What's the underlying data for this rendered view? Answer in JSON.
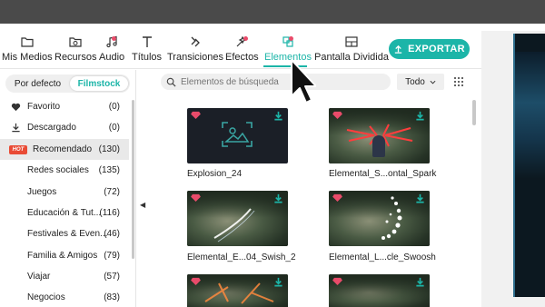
{
  "toolbar": {
    "items": [
      {
        "label": "Mis Medios",
        "icon": "folder-icon"
      },
      {
        "label": "Recursos",
        "icon": "cloud-folder-icon"
      },
      {
        "label": "Audio",
        "icon": "music-note-icon"
      },
      {
        "label": "Títulos",
        "icon": "text-icon"
      },
      {
        "label": "Transiciones",
        "icon": "transition-icon"
      },
      {
        "label": "Efectos",
        "icon": "sparkle-icon"
      },
      {
        "label": "Elementos",
        "icon": "elements-icon"
      },
      {
        "label": "Pantalla Dividida",
        "icon": "split-screen-icon"
      }
    ],
    "active": "Elementos",
    "export_label": "EXPORTAR"
  },
  "sidebar": {
    "segments": [
      "Por defecto",
      "Filmstock"
    ],
    "selected_segment": "Filmstock",
    "categories": [
      {
        "label": "Favorito",
        "count": "(0)",
        "icon": "heart-icon"
      },
      {
        "label": "Descargado",
        "count": "(0)",
        "icon": "download-icon"
      },
      {
        "label": "Recomendado",
        "count": "(130)",
        "icon": "hot-badge-icon",
        "badge": "HOT"
      },
      {
        "label": "Redes sociales",
        "count": "(135)"
      },
      {
        "label": "Juegos",
        "count": "(72)"
      },
      {
        "label": "Educación & Tut...",
        "count": "(116)"
      },
      {
        "label": "Festivales & Even...",
        "count": "(46)"
      },
      {
        "label": "Familia & Amigos",
        "count": "(79)"
      },
      {
        "label": "Viajar",
        "count": "(57)"
      },
      {
        "label": "Negocios",
        "count": "(83)"
      }
    ],
    "selected_category": "Recomendado"
  },
  "search": {
    "placeholder": "Elementos de búsqueda"
  },
  "filter": {
    "label": "Todo"
  },
  "grid": {
    "items": [
      {
        "label": "Explosion_24"
      },
      {
        "label": "Elemental_S...ontal_Spark"
      },
      {
        "label": "Elemental_E...04_Swish_2"
      },
      {
        "label": "Elemental_L...cle_Swoosh"
      },
      {
        "label": ""
      },
      {
        "label": ""
      }
    ]
  },
  "colors": {
    "accent": "#1cb5a8",
    "premium": "#e94b6a",
    "hot": "#e94b35",
    "dark_bar": "#4a4a4a"
  }
}
